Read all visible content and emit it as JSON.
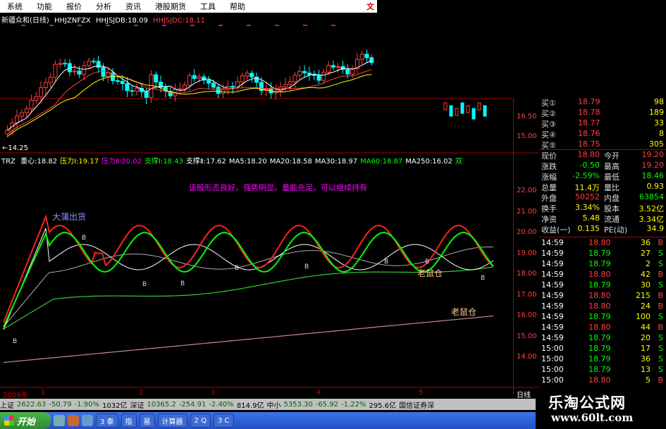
{
  "menu": {
    "items": [
      "系统",
      "功能",
      "报价",
      "分析",
      "资讯",
      "港股期货",
      "工具",
      "帮助"
    ],
    "right": "文"
  },
  "header": {
    "title": "新疆众和(日线)",
    "ma1": "HHJZNFZX",
    "ma2": "HHJSJDB:18.09",
    "ma3": "HHJSJDC:18.11"
  },
  "price_chart": {
    "ticks": [
      "16.50",
      "15.00"
    ],
    "low_marker": "←14.25"
  },
  "indicator": {
    "name": "TRZ",
    "items": [
      {
        "text": "重心:18.82",
        "color": "#ffffff"
      },
      {
        "text": "压力Ⅰ:19.17",
        "color": "#ffff00"
      },
      {
        "text": "压力Ⅱ:20.02",
        "color": "#ff00ff"
      },
      {
        "text": "支撑Ⅰ:18.43",
        "color": "#00ff00"
      },
      {
        "text": "支撑Ⅱ:17.62",
        "color": "#ffffff"
      },
      {
        "text": "MA5:18.20",
        "color": "#ffffff"
      },
      {
        "text": "MA20:18.58",
        "color": "#ffffff"
      },
      {
        "text": "MA30:18.97",
        "color": "#ffffff"
      },
      {
        "text": "MA60:18.87",
        "color": "#00ff00"
      },
      {
        "text": "MA250:16.02",
        "color": "#ffffff"
      },
      {
        "text": "双",
        "color": "#00ff00"
      }
    ],
    "ticks": [
      "22.00",
      "21.00",
      "20.00",
      "19.00",
      "18.00",
      "17.00",
      "16.00",
      "15.00",
      "14.00"
    ],
    "comment": "该股形态良好，强势明显，量能充足，可以继续持有",
    "label_big": "大蒲出货",
    "label_mouse1": "老鼠仓",
    "label_mouse2": "老鼠仓",
    "b_marker": "B"
  },
  "quotes": {
    "buys": [
      {
        "label": "买①",
        "price": "18.79",
        "vol": "98"
      },
      {
        "label": "买②",
        "price": "18.78",
        "vol": "189"
      },
      {
        "label": "买③",
        "price": "18.77",
        "vol": "33"
      },
      {
        "label": "买④",
        "price": "18.76",
        "vol": "8"
      },
      {
        "label": "买⑤",
        "price": "18.75",
        "vol": "305"
      }
    ]
  },
  "stats": [
    {
      "k1": "现价",
      "v1": "18.80",
      "k2": "今开",
      "v2": "19.20",
      "c1": "#ff4040",
      "c2": "#ff4040"
    },
    {
      "k1": "涨跌",
      "v1": "-0.50",
      "k2": "最高",
      "v2": "19.20",
      "c1": "#00ff00",
      "c2": "#ff4040"
    },
    {
      "k1": "涨幅",
      "v1": "-2.59%",
      "k2": "最低",
      "v2": "18.46",
      "c1": "#00ff00",
      "c2": "#00ff00"
    },
    {
      "k1": "总量",
      "v1": "11.4万",
      "k2": "量比",
      "v2": "0.93",
      "c1": "#ffff00",
      "c2": "#ffff00"
    },
    {
      "k1": "外盘",
      "v1": "50252",
      "k2": "内盘",
      "v2": "63854",
      "c1": "#ff4040",
      "c2": "#00ff00"
    },
    {
      "k1": "换手",
      "v1": "3.34%",
      "k2": "股本",
      "v2": "3.52亿",
      "c1": "#ffff00",
      "c2": "#ffff00"
    },
    {
      "k1": "净资",
      "v1": "5.48",
      "k2": "流通",
      "v2": "3.34亿",
      "c1": "#ffff00",
      "c2": "#ffff00"
    },
    {
      "k1": "收益(一)",
      "v1": "0.135",
      "k2": "PE(动)",
      "v2": "34.9",
      "c1": "#ffff00",
      "c2": "#ffff00"
    }
  ],
  "ticks": [
    {
      "t": "14:59",
      "p": "18.80",
      "v": "36",
      "s": "B"
    },
    {
      "t": "14:59",
      "p": "18.79",
      "v": "27",
      "s": "S"
    },
    {
      "t": "14:59",
      "p": "18.79",
      "v": "2",
      "s": "S"
    },
    {
      "t": "14:59",
      "p": "18.80",
      "v": "42",
      "s": "B"
    },
    {
      "t": "14:59",
      "p": "18.79",
      "v": "30",
      "s": "S"
    },
    {
      "t": "14:59",
      "p": "18.80",
      "v": "215",
      "s": "B"
    },
    {
      "t": "14:59",
      "p": "18.80",
      "v": "24",
      "s": "B"
    },
    {
      "t": "14:59",
      "p": "18.79",
      "v": "100",
      "s": "S"
    },
    {
      "t": "14:59",
      "p": "18.80",
      "v": "44",
      "s": "B"
    },
    {
      "t": "14:59",
      "p": "18.79",
      "v": "20",
      "s": "S"
    },
    {
      "t": "15:00",
      "p": "18.79",
      "v": "17",
      "s": "S"
    },
    {
      "t": "15:00",
      "p": "18.79",
      "v": "36",
      "s": "S"
    },
    {
      "t": "15:00",
      "p": "18.79",
      "v": "13",
      "s": "S"
    },
    {
      "t": "15:00",
      "p": "18.80",
      "v": "5",
      "s": "B"
    }
  ],
  "datebar": {
    "year": "2009年",
    "months": [
      "1",
      "2",
      "3",
      "4",
      "5"
    ],
    "right": "日线"
  },
  "status": {
    "items": [
      {
        "text": "上证",
        "cls": ""
      },
      {
        "text": "2622.63",
        "cls": "dn"
      },
      {
        "text": "-50.79",
        "cls": "dn"
      },
      {
        "text": "-1.90%",
        "cls": "dn"
      },
      {
        "text": "1032亿",
        "cls": ""
      },
      {
        "text": "深证",
        "cls": ""
      },
      {
        "text": "10365.2",
        "cls": "dn"
      },
      {
        "text": "-254.91",
        "cls": "dn"
      },
      {
        "text": "-2.40%",
        "cls": "dn"
      },
      {
        "text": "814.9亿",
        "cls": ""
      },
      {
        "text": "中小",
        "cls": ""
      },
      {
        "text": "5353.30",
        "cls": "dn"
      },
      {
        "text": "-65.92",
        "cls": "dn"
      },
      {
        "text": "-1.22%",
        "cls": "dn"
      },
      {
        "text": "295.6亿",
        "cls": ""
      },
      {
        "text": "国信证券深",
        "cls": ""
      }
    ]
  },
  "taskbar": {
    "start": "开始",
    "buttons": [
      "3 泰",
      "指",
      "易",
      "计算器",
      "2 Q",
      "3 C"
    ]
  },
  "watermark": {
    "cn": "乐淘公式网",
    "url": "www.60lt.com"
  },
  "colors": {
    "up": "#ff4040",
    "down": "#00ffff",
    "ma": "#ffffff",
    "accent": "#ffff00"
  }
}
